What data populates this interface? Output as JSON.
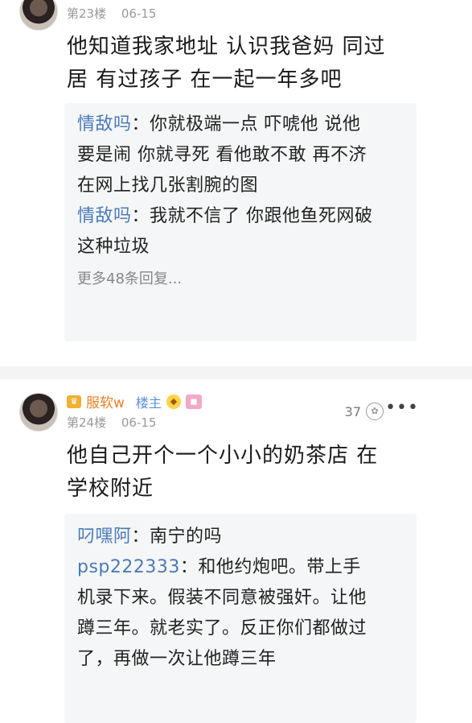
{
  "post23": {
    "floor": "第23楼",
    "date": "06-15",
    "content_lines": [
      "他知道我家地址 认识我爸妈 同过",
      "居 有过孩子 在一起一年多吧"
    ],
    "replies": [
      {
        "nick": "情敌吗",
        "sep": "：",
        "lines": [
          "你就极端一点 吓唬他 说他",
          "要是闹 你就寻死 看他敢不敢 再不济",
          "在网上找几张割腕的图"
        ]
      },
      {
        "nick": "情敌吗",
        "sep": "：",
        "lines": [
          "我就不信了 你跟他鱼死网破",
          " 这种垃圾"
        ]
      }
    ],
    "more_replies": "更多48条回复..."
  },
  "post24": {
    "username": "服软w",
    "owner_tag": "楼主",
    "floor": "第24楼",
    "date": "06-15",
    "like_count": "37",
    "more_icon": "more-dots",
    "content_lines": [
      "他自己开个一个小小的奶茶店 在",
      "学校附近"
    ],
    "replies": [
      {
        "nick": "叼嘿阿",
        "sep": "：",
        "lines": [
          "南宁的吗"
        ]
      },
      {
        "nick": "psp222333",
        "sep": "：",
        "lines": [
          "和他约炮吧。带上手",
          "机录下来。假装不同意被强奸。让他",
          "蹲三年。就老实了。反正你们都做过",
          "了，再做一次让他蹲三年"
        ]
      }
    ]
  },
  "colors": {
    "nick": "#4a7ab8",
    "username": "#e8822a",
    "owner": "#5b8fd6",
    "reply_bg": "#f5f6f7"
  }
}
